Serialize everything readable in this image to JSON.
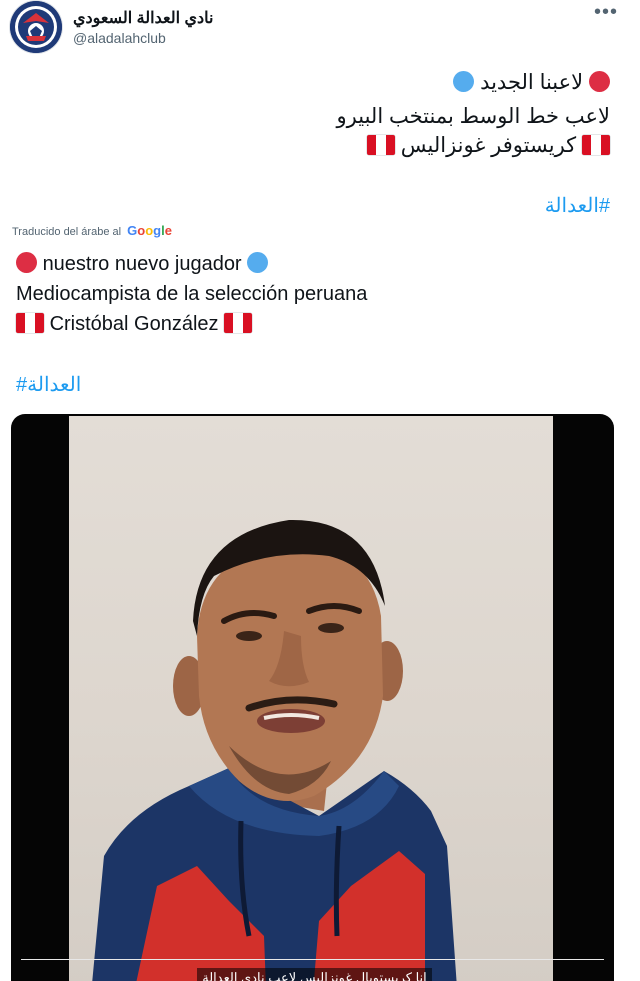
{
  "author": {
    "name": "نادي العدالة السعودي",
    "handle": "@aladalahclub"
  },
  "menu": {
    "icon": "more-icon",
    "glyph": "•••"
  },
  "tweet": {
    "ar_line1": "لاعبنا الجديد",
    "ar_line2": "لاعب خط الوسط بمنتخب البيرو",
    "ar_line3": "كريستوفر غونزاليس",
    "hashtag": "#العدالة"
  },
  "translation": {
    "label": "Traducido del árabe al",
    "brand": [
      "G",
      "o",
      "o",
      "g",
      "l",
      "e"
    ],
    "es_line1": "nuestro nuevo jugador",
    "es_line2": "Mediocampista de la selección peruana",
    "es_line3": "Cristóbal González",
    "hashtag": "#العدالة"
  },
  "video": {
    "subtitle": "انا كريستوبال غونزاليس لاعب نادي العدالة"
  },
  "colors": {
    "red_dot": "#dd2e44",
    "blue_dot": "#55acee",
    "link": "#1d9bf0",
    "peru_red": "#d91023",
    "hoodie_navy": "#1c3566",
    "hoodie_red": "#d2302b"
  }
}
